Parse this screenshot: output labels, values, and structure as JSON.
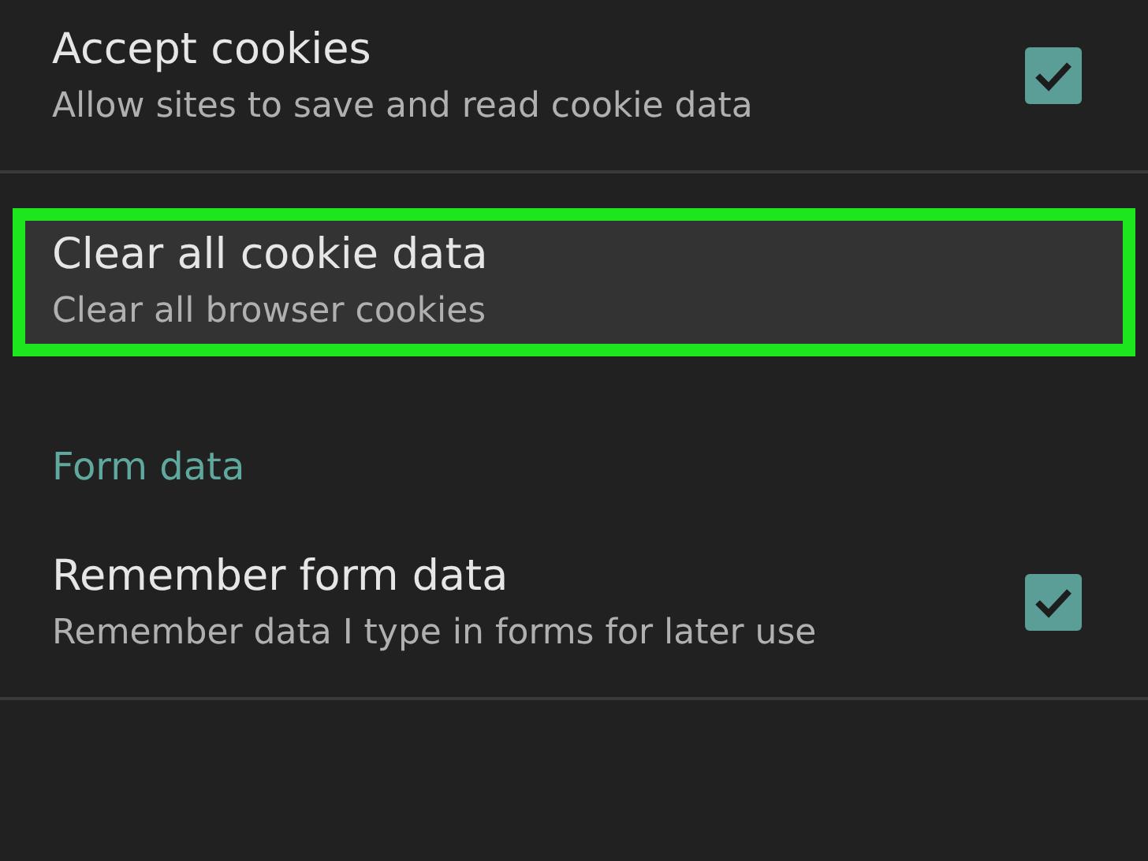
{
  "items": [
    {
      "kind": "setting",
      "title": "Accept cookies",
      "summary": "Allow sites to save and read cookie data",
      "checked": true,
      "highlighted": false
    },
    {
      "kind": "divider"
    },
    {
      "kind": "setting",
      "title": "Clear all cookie data",
      "summary": "Clear all browser cookies",
      "highlighted": true
    },
    {
      "kind": "header",
      "title": "Form data"
    },
    {
      "kind": "setting",
      "title": "Remember form data",
      "summary": "Remember data I type in forms for later use",
      "checked": true,
      "highlighted": false
    },
    {
      "kind": "divider"
    }
  ]
}
